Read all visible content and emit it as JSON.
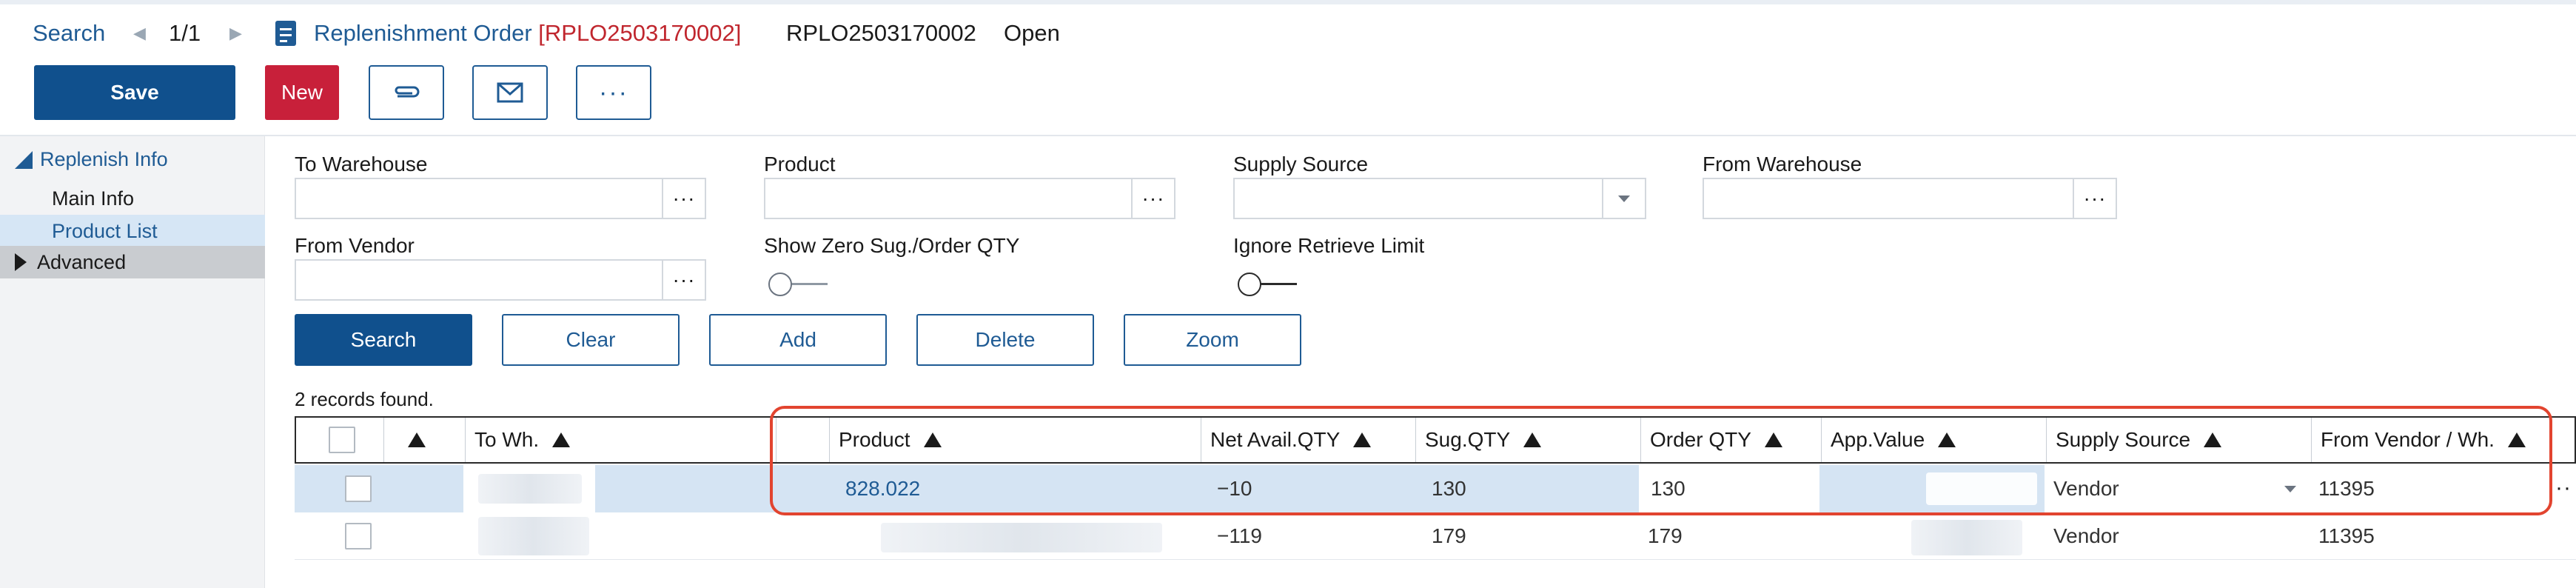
{
  "header": {
    "search_link": "Search",
    "nav_prev": "◀",
    "pager": "1/1",
    "nav_next": "▶",
    "title": "Replenishment Order",
    "title_code": "[RPLO2503170002]",
    "order_no": "RPLO2503170002",
    "status": "Open"
  },
  "toolbar": {
    "save_label": "Save",
    "new_label": "New",
    "more_label": "···"
  },
  "sidebar": {
    "group_label": "Replenish Info",
    "items": [
      {
        "label": "Main Info"
      },
      {
        "label": "Product List"
      }
    ],
    "advanced_label": "Advanced"
  },
  "filters": {
    "to_warehouse_label": "To Warehouse",
    "product_label": "Product",
    "supply_source_label": "Supply Source",
    "from_warehouse_label": "From Warehouse",
    "from_vendor_label": "From Vendor",
    "show_zero_label": "Show Zero Sug./Order QTY",
    "ignore_limit_label": "Ignore Retrieve Limit",
    "lookup_glyph": "···"
  },
  "actions": {
    "search": "Search",
    "clear": "Clear",
    "add": "Add",
    "delete": "Delete",
    "zoom": "Zoom"
  },
  "records_found": "2 records found.",
  "grid": {
    "columns": {
      "to_wh": "To Wh.",
      "product": "Product",
      "net_avail": "Net Avail.QTY",
      "sug_qty": "Sug.QTY",
      "order_qty": "Order QTY",
      "app_value": "App.Value",
      "supply_source": "Supply Source",
      "from_vendor": "From Vendor / Wh."
    },
    "rows": [
      {
        "product": "828.022",
        "net_avail": "−10",
        "sug_qty": "130",
        "order_qty": "130",
        "supply_source": "Vendor",
        "from_vendor": "11395",
        "more": "···"
      },
      {
        "product": "",
        "net_avail": "−119",
        "sug_qty": "179",
        "order_qty": "179",
        "supply_source": "Vendor",
        "from_vendor": "11395"
      }
    ]
  },
  "colors": {
    "primary": "#10508d",
    "danger": "#c8203a",
    "highlight": "#e2442f",
    "selected_row": "#d5e4f3"
  }
}
